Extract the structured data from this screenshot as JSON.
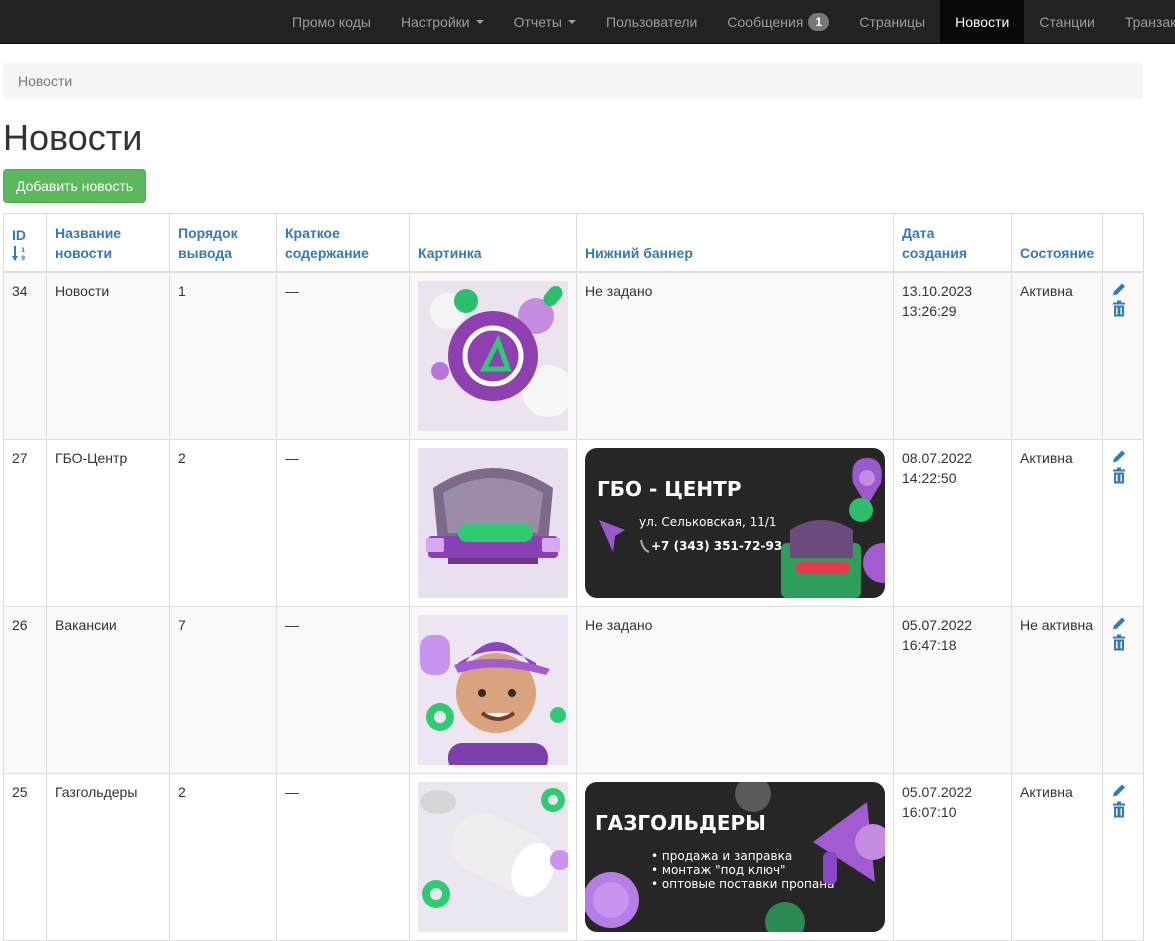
{
  "nav": {
    "items": [
      {
        "label": "Промо коды"
      },
      {
        "label": "Настройки",
        "dropdown": true
      },
      {
        "label": "Отчеты",
        "dropdown": true
      },
      {
        "label": "Пользователи"
      },
      {
        "label": "Сообщения",
        "badge": "1"
      },
      {
        "label": "Страницы"
      },
      {
        "label": "Новости",
        "active": true
      },
      {
        "label": "Станции"
      },
      {
        "label": "Транзакции"
      }
    ]
  },
  "breadcrumb": {
    "current": "Новости"
  },
  "page": {
    "title": "Новости",
    "add_button": "Добавить новость"
  },
  "table": {
    "headers": {
      "id": "ID",
      "name": "Название новости",
      "order": "Порядок вывода",
      "summary": "Краткое содержание",
      "image": "Картинка",
      "banner": "Нижний баннер",
      "created": "Дата создания",
      "status": "Состояние"
    },
    "rows": [
      {
        "id": "34",
        "name": "Новости",
        "order": "1",
        "summary": "—",
        "banner_text": "Не задано",
        "date": "13.10.2023",
        "time": "13:26:29",
        "status": "Активна"
      },
      {
        "id": "27",
        "name": "ГБО-Центр",
        "order": "2",
        "summary": "—",
        "banner": {
          "title": "ГБО - ЦЕНТР",
          "address": "ул. Сельковская, 11/1",
          "phone": "+7 (343) 351-72-93"
        },
        "date": "08.07.2022",
        "time": "14:22:50",
        "status": "Активна"
      },
      {
        "id": "26",
        "name": "Вакансии",
        "order": "7",
        "summary": "—",
        "banner_text": "Не задано",
        "date": "05.07.2022",
        "time": "16:47:18",
        "status": "Не активна"
      },
      {
        "id": "25",
        "name": "Газгольдеры",
        "order": "2",
        "summary": "—",
        "banner": {
          "title": "ГАЗГОЛЬДЕРЫ",
          "bullets": [
            "продажа и заправка",
            "монтаж \"под ключ\"",
            "оптовые поставки пропана"
          ]
        },
        "date": "05.07.2022",
        "time": "16:07:10",
        "status": "Активна"
      }
    ]
  },
  "colors": {
    "navbar": "#222222",
    "link": "#337ab7",
    "success": "#5cb85c",
    "accent_purple": "#8e44ad",
    "accent_green": "#2ecc71"
  },
  "icons": {
    "sort": "sort-numeric-asc-icon",
    "edit": "pencil-icon",
    "delete": "trash-icon"
  }
}
